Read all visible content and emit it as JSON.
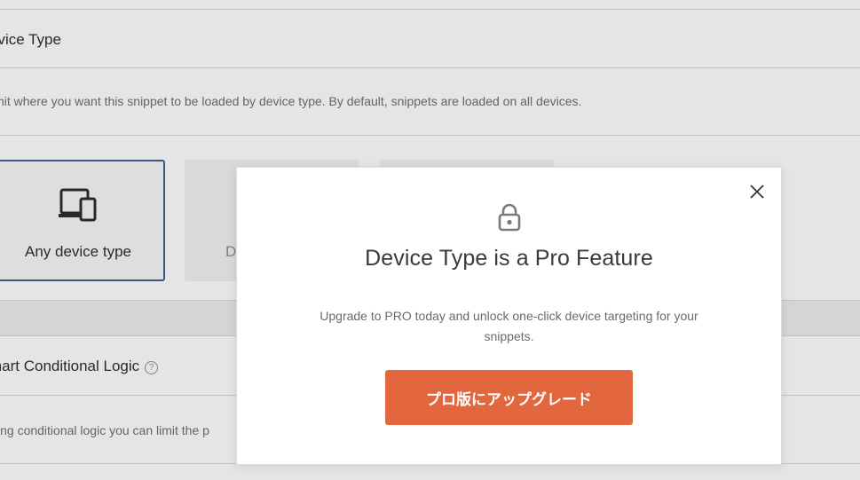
{
  "background": {
    "device_type_section": {
      "title": "evice Type",
      "description": "imit where you want this snippet to be loaded by device type. By default, snippets are loaded on all devices.",
      "options": [
        {
          "label": "Any device type",
          "icon": "devices-icon",
          "selected": true
        },
        {
          "label": "D",
          "icon": "desktop-icon",
          "selected": false
        },
        {
          "label": "",
          "icon": "mobile-icon",
          "selected": false
        }
      ]
    },
    "smart_logic_section": {
      "title": "mart Conditional Logic",
      "help_glyph": "?",
      "description": "sing conditional logic you can limit the p"
    }
  },
  "modal": {
    "icon": "lock-icon",
    "title": "Device Type is a Pro Feature",
    "text": "Upgrade to PRO today and unlock one-click device targeting for your snippets.",
    "button_label": "プロ版にアップグレード",
    "close_icon": "close-icon",
    "button_color": "#e2673f"
  }
}
